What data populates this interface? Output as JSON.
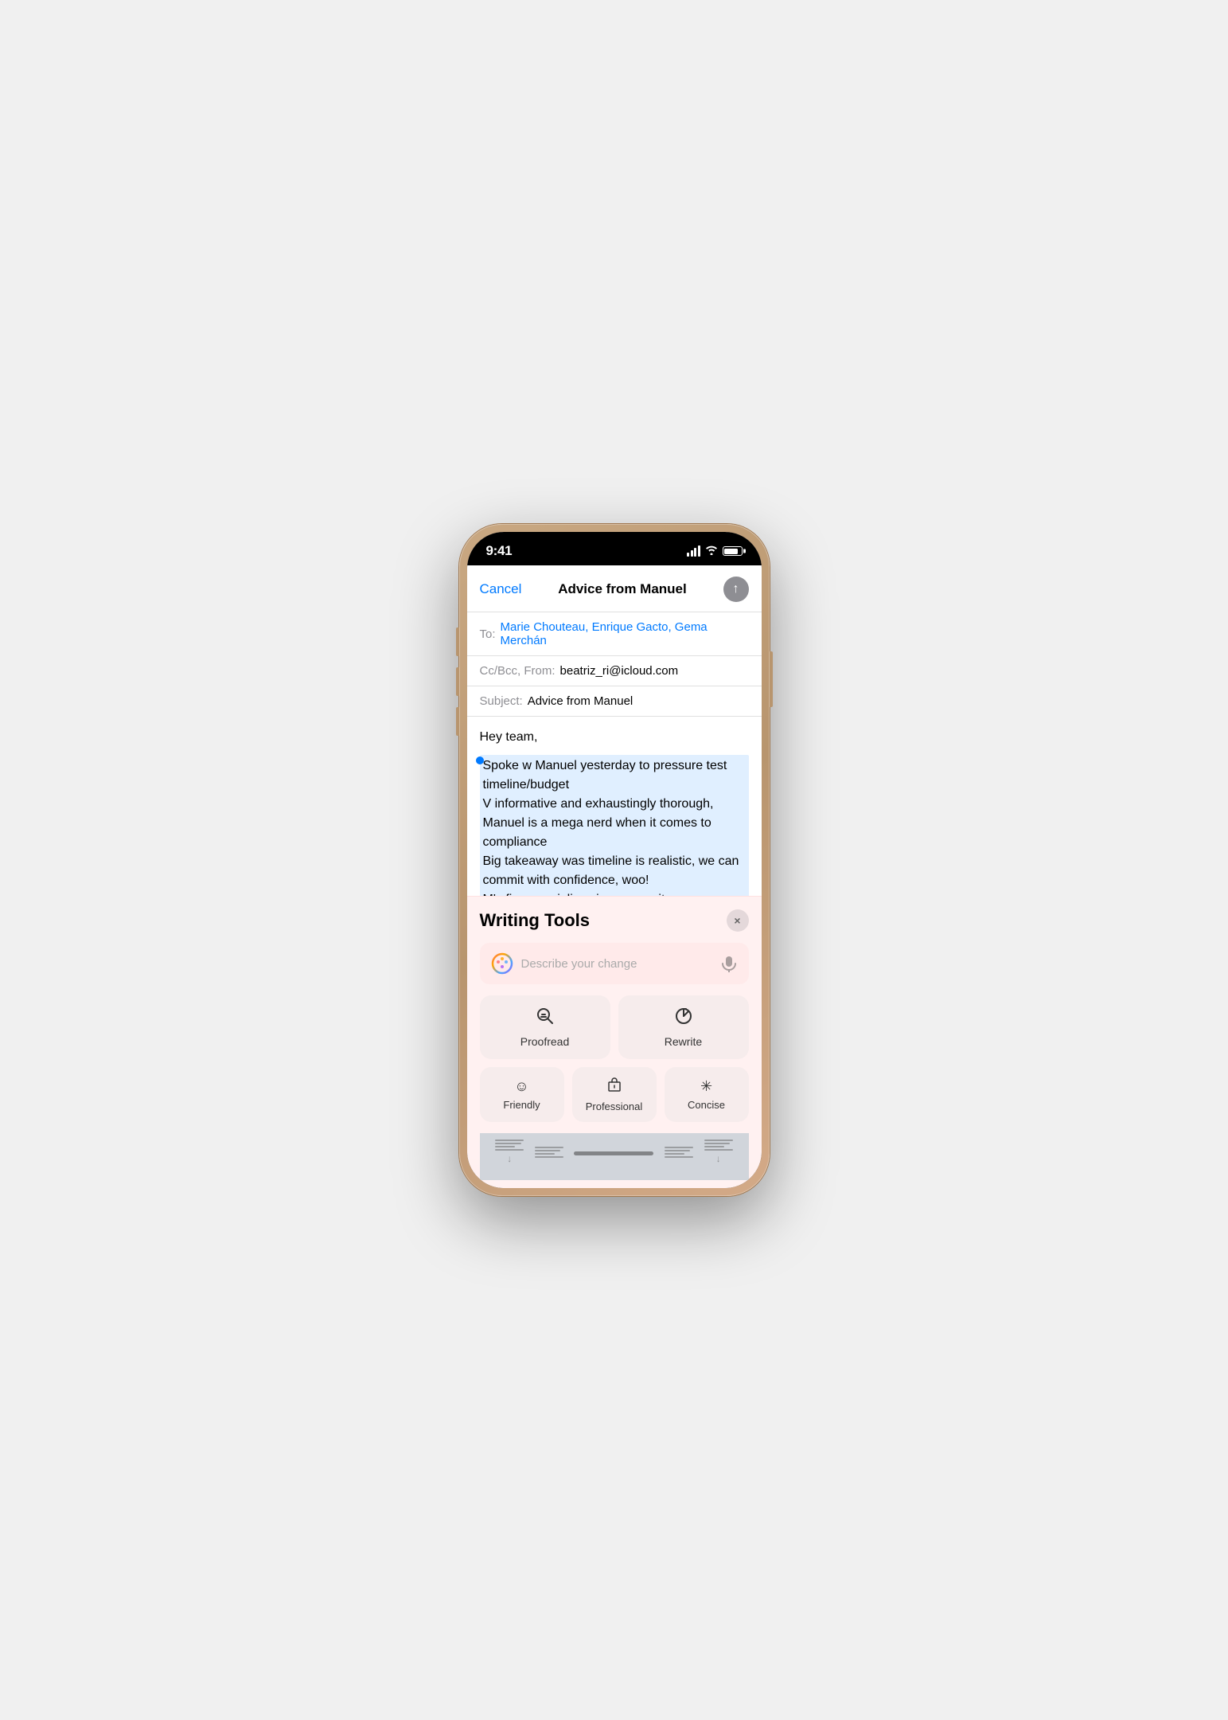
{
  "phone": {
    "status_bar": {
      "time": "9:41",
      "signal_label": "signal",
      "wifi_label": "wifi",
      "battery_label": "battery"
    }
  },
  "compose": {
    "cancel_label": "Cancel",
    "title": "Advice from Manuel",
    "to_label": "To:",
    "to_value": "Marie Chouteau, Enrique Gacto, Gema Merchán",
    "cc_label": "Cc/Bcc, From:",
    "cc_value": "beatriz_ri@icloud.com",
    "subject_label": "Subject:",
    "subject_value": "Advice from Manuel",
    "body_greeting": "Hey team,",
    "body_selected": "Spoke w Manuel yesterday to pressure test timeline/budget\nV informative and exhaustingly thorough, Manuel is a mega nerd when it comes to compliance\nBig takeaway was timeline is realistic, we can commit with confidence, woo!\nM's firm specializes in community consultation, we need help here, should consider engaging them for our/for..."
  },
  "writing_tools": {
    "title": "Writing Tools",
    "close_label": "×",
    "input_placeholder": "Describe your change",
    "proofread_label": "Proofread",
    "rewrite_label": "Rewrite",
    "friendly_label": "Friendly",
    "professional_label": "Professional",
    "concise_label": "Concise"
  }
}
